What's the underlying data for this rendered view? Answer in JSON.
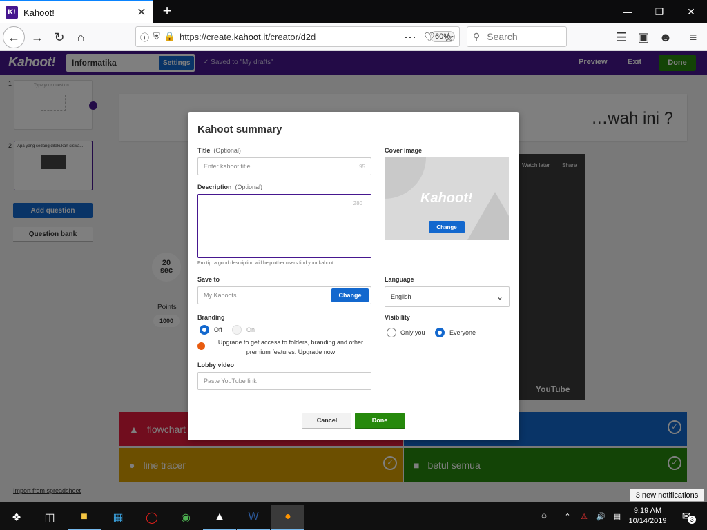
{
  "browser": {
    "tab_title": "Kahoot!",
    "tab_favicon": "K!",
    "tab_close": "✕",
    "new_tab": "+",
    "url_prefix": "https://create.",
    "url_domain": "kahoot.it",
    "url_suffix": "/creator/d2d",
    "zoom": "60%",
    "search_placeholder": "Search",
    "window_controls": [
      "minimize-icon",
      "restore-icon",
      "close-icon"
    ]
  },
  "kahoot": {
    "logo": "Kahoot!",
    "kahoot_title": "Informatika",
    "settings_label": "Settings",
    "saved_status": "Saved to \"My drafts\"",
    "preview_label": "Preview",
    "exit_label": "Exit",
    "done_label": "Done",
    "questions": [
      {
        "num": "1",
        "title": "Type your question"
      },
      {
        "num": "2",
        "title": "Apa yang sedang dilakukan siswa..."
      }
    ],
    "add_question": "Add question",
    "question_bank": "Question bank",
    "import_link": "Import from spreadsheet",
    "question_text": "…wah ini ?",
    "timer_value": "20",
    "timer_unit": "sec",
    "points_label": "Points",
    "points_value": "1000",
    "video_watch_later": "Watch later",
    "video_share": "Share",
    "video_brand": "YouTube",
    "answers": [
      {
        "text": "flowchart",
        "color": "#e21b3c",
        "shape": "triangle-icon"
      },
      {
        "text": "",
        "color": "#1368ce",
        "shape": "diamond-icon"
      },
      {
        "text": "line tracer",
        "color": "#d89e00",
        "shape": "circle-icon"
      },
      {
        "text": "betul semua",
        "color": "#26890c",
        "shape": "square-icon"
      }
    ]
  },
  "modal": {
    "title": "Kahoot summary",
    "title_label": "Title",
    "title_optional": "(Optional)",
    "title_placeholder": "Enter kahoot title...",
    "title_counter": "95",
    "description_label": "Description",
    "description_optional": "(Optional)",
    "description_counter": "280",
    "protip": "Pro tip: a good description will help other users find your kahoot",
    "cover_label": "Cover image",
    "cover_logo": "Kahoot!",
    "cover_change": "Change",
    "save_to_label": "Save to",
    "save_to_value": "My Kahoots",
    "save_to_change": "Change",
    "language_label": "Language",
    "language_value": "English",
    "branding_label": "Branding",
    "branding_off": "Off",
    "branding_on": "On",
    "branding_selected": "Off",
    "upgrade_text": "Upgrade to get access to folders, branding and other premium features.",
    "upgrade_link": "Upgrade now",
    "visibility_label": "Visibility",
    "visibility_only_you": "Only you",
    "visibility_everyone": "Everyone",
    "visibility_selected": "Everyone",
    "lobby_video_label": "Lobby video",
    "lobby_video_placeholder": "Paste YouTube link",
    "cancel_label": "Cancel",
    "done_label": "Done"
  },
  "taskbar": {
    "time": "9:19 AM",
    "date": "10/14/2019",
    "notification_tip": "3 new notifications",
    "notification_count": "3"
  }
}
